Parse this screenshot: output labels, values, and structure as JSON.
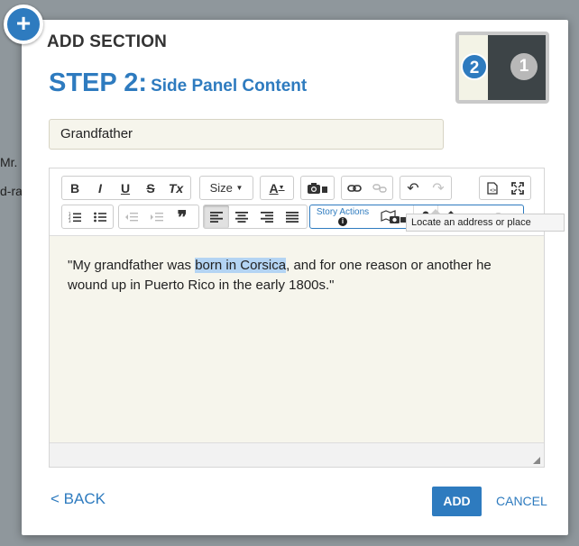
{
  "backdrop": {
    "line1": "Mr.",
    "line2": "d-ra"
  },
  "dialog": {
    "title": "ADD SECTION",
    "step_number": "STEP 2:",
    "step_label": "Side Panel Content",
    "thumb": {
      "badge_active": "2",
      "badge_inactive": "1"
    }
  },
  "title_field": {
    "value": "Grandfather"
  },
  "toolbar": {
    "bold": "B",
    "italic": "I",
    "underline": "U",
    "strike": "S",
    "clear_format": "Tx",
    "size_label": "Size",
    "font_color": "A",
    "quote": "❞",
    "story_actions_label": "Story Actions",
    "story_actions_info": "i"
  },
  "tooltip": {
    "text": "Locate an address or place"
  },
  "content": {
    "before": "\"My grandfather was ",
    "highlighted": "born in Corsica",
    "after": ", and for one reason or another he wound up in Puerto Rico in the early 1800s.\""
  },
  "footer": {
    "back": "< BACK",
    "add": "ADD",
    "cancel": "CANCEL"
  },
  "colors": {
    "accent": "#2e7bbf",
    "editor_bg": "#f6f5ec",
    "thumb_dark": "#3d4447"
  },
  "icons": [
    "plus-icon",
    "camera-icon",
    "link-icon",
    "unlink-icon",
    "undo-icon",
    "redo-icon",
    "source-icon",
    "maximize-icon",
    "numbered-list-icon",
    "bullet-list-icon",
    "outdent-icon",
    "indent-icon",
    "align-left-icon",
    "align-center-icon",
    "align-right-icon",
    "justify-icon",
    "map-media-icon",
    "locate-pin-icon",
    "vertical-resize-icon",
    "eye-icon",
    "unlink-action-icon"
  ]
}
